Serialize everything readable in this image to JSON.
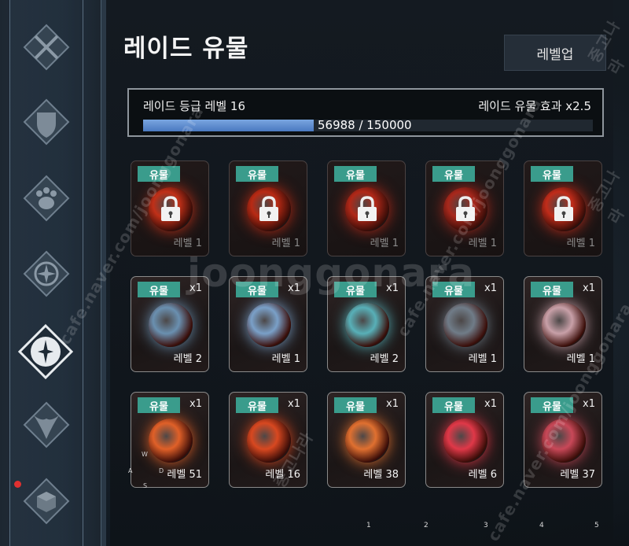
{
  "title": "레이드 유물",
  "levelup_button": "레벨업",
  "grade": {
    "label": "레이드 등급 레벨 16",
    "effect": "레이드 유물 효과 x2.5",
    "progress_text": "56988 / 150000",
    "progress_fraction": 0.3799
  },
  "sidebar": {
    "icons": [
      "crossed-swords-icon",
      "shield-icon",
      "paw-icon",
      "compass-icon",
      "star-compass-icon",
      "wing-crest-icon",
      "cube-icon"
    ]
  },
  "relics": [
    {
      "badge": "유물",
      "qty": "",
      "level": "레벨 1",
      "locked": true,
      "color": "#c03018"
    },
    {
      "badge": "유물",
      "qty": "",
      "level": "레벨 1",
      "locked": true,
      "color": "#b82a14"
    },
    {
      "badge": "유물",
      "qty": "",
      "level": "레벨 1",
      "locked": true,
      "color": "#b02818"
    },
    {
      "badge": "유물",
      "qty": "",
      "level": "레벨 1",
      "locked": true,
      "color": "#a8281c"
    },
    {
      "badge": "유물",
      "qty": "",
      "level": "레벨 1",
      "locked": true,
      "color": "#c02c1a"
    },
    {
      "badge": "유물",
      "qty": "x1",
      "level": "레벨 2",
      "locked": false,
      "color": "#6a90b0"
    },
    {
      "badge": "유물",
      "qty": "x1",
      "level": "레벨 1",
      "locked": false,
      "color": "#7aa0c8"
    },
    {
      "badge": "유물",
      "qty": "x1",
      "level": "레벨 2",
      "locked": false,
      "color": "#58b0b8"
    },
    {
      "badge": "유물",
      "qty": "x1",
      "level": "레벨 1",
      "locked": false,
      "color": "#707c88"
    },
    {
      "badge": "유물",
      "qty": "x1",
      "level": "레벨 1",
      "locked": false,
      "color": "#c8a0a8"
    },
    {
      "badge": "유물",
      "qty": "x1",
      "level": "레벨 51",
      "locked": false,
      "color": "#e06028"
    },
    {
      "badge": "유물",
      "qty": "x1",
      "level": "레벨 16",
      "locked": false,
      "color": "#d84820"
    },
    {
      "badge": "유물",
      "qty": "x1",
      "level": "레벨 38",
      "locked": false,
      "color": "#e07030"
    },
    {
      "badge": "유물",
      "qty": "x1",
      "level": "레벨 6",
      "locked": false,
      "color": "#e03848"
    },
    {
      "badge": "유물",
      "qty": "x1",
      "level": "레벨 37",
      "locked": false,
      "color": "#c84858"
    }
  ],
  "controls_hint": {
    "w": "W",
    "a": "A",
    "d": "D",
    "s": "S"
  },
  "slot_numbers": [
    "1",
    "2",
    "3",
    "4",
    "5"
  ],
  "watermarks": [
    "joonggonara",
    "cafe.naver.com/joonggonara",
    "중고나라"
  ]
}
